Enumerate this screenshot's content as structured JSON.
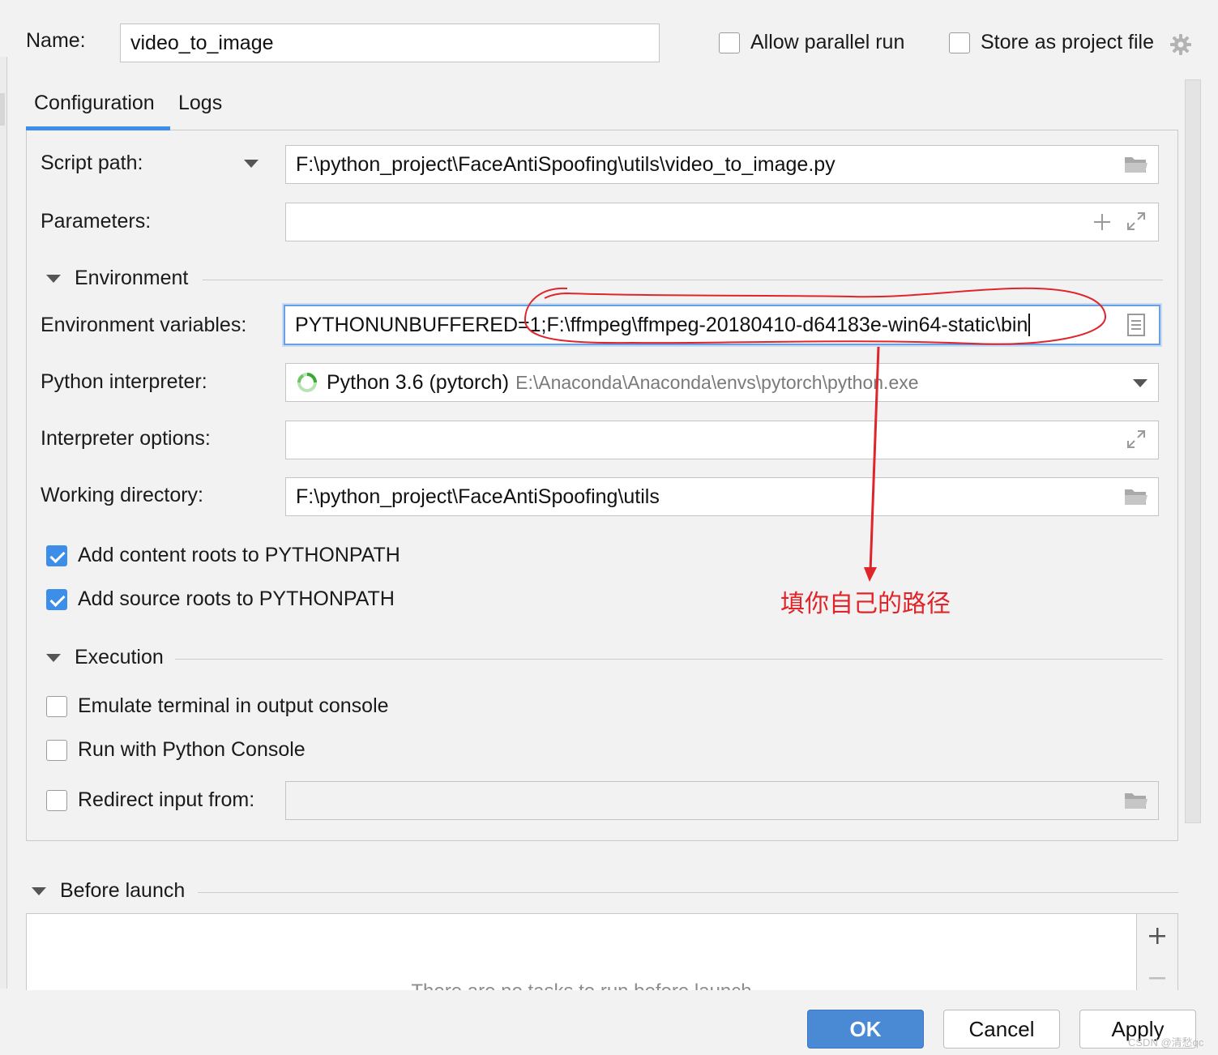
{
  "header": {
    "name_label": "Name:",
    "name_value": "video_to_image",
    "allow_parallel_run_label": "Allow parallel run",
    "store_as_project_file_label": "Store as project file"
  },
  "tabs": [
    {
      "label": "Configuration",
      "selected": true
    },
    {
      "label": "Logs",
      "selected": false
    }
  ],
  "form": {
    "script_path_label": "Script path:",
    "script_path_value": "F:\\python_project\\FaceAntiSpoofing\\utils\\video_to_image.py",
    "parameters_label": "Parameters:",
    "parameters_value": "",
    "environment_section": "Environment",
    "env_vars_label": "Environment variables:",
    "env_vars_value": "PYTHONUNBUFFERED=1;F:\\ffmpeg\\ffmpeg-20180410-d64183e-win64-static\\bin",
    "interpreter_label": "Python interpreter:",
    "interpreter_name": "Python 3.6 (pytorch)",
    "interpreter_path": "E:\\Anaconda\\Anaconda\\envs\\pytorch\\python.exe",
    "interpreter_options_label": "Interpreter options:",
    "interpreter_options_value": "",
    "working_dir_label": "Working directory:",
    "working_dir_value": "F:\\python_project\\FaceAntiSpoofing\\utils",
    "add_content_roots_label": "Add content roots to PYTHONPATH",
    "add_source_roots_label": "Add source roots to PYTHONPATH",
    "execution_section": "Execution",
    "emulate_terminal_label": "Emulate terminal in output console",
    "run_with_console_label": "Run with Python Console",
    "redirect_input_label": "Redirect input from:",
    "redirect_input_value": ""
  },
  "before_launch": {
    "section": "Before launch",
    "empty_text": "There are no tasks to run before launch"
  },
  "annotation": {
    "text": "填你自己的路径",
    "color": "#e0252a"
  },
  "buttons": {
    "ok": "OK",
    "cancel": "Cancel",
    "apply": "Apply"
  },
  "watermark": "CSDN @清愁qc",
  "colors": {
    "accent": "#3d8ee8",
    "primary_button": "#4a89d4",
    "annotation": "#e0252a"
  }
}
